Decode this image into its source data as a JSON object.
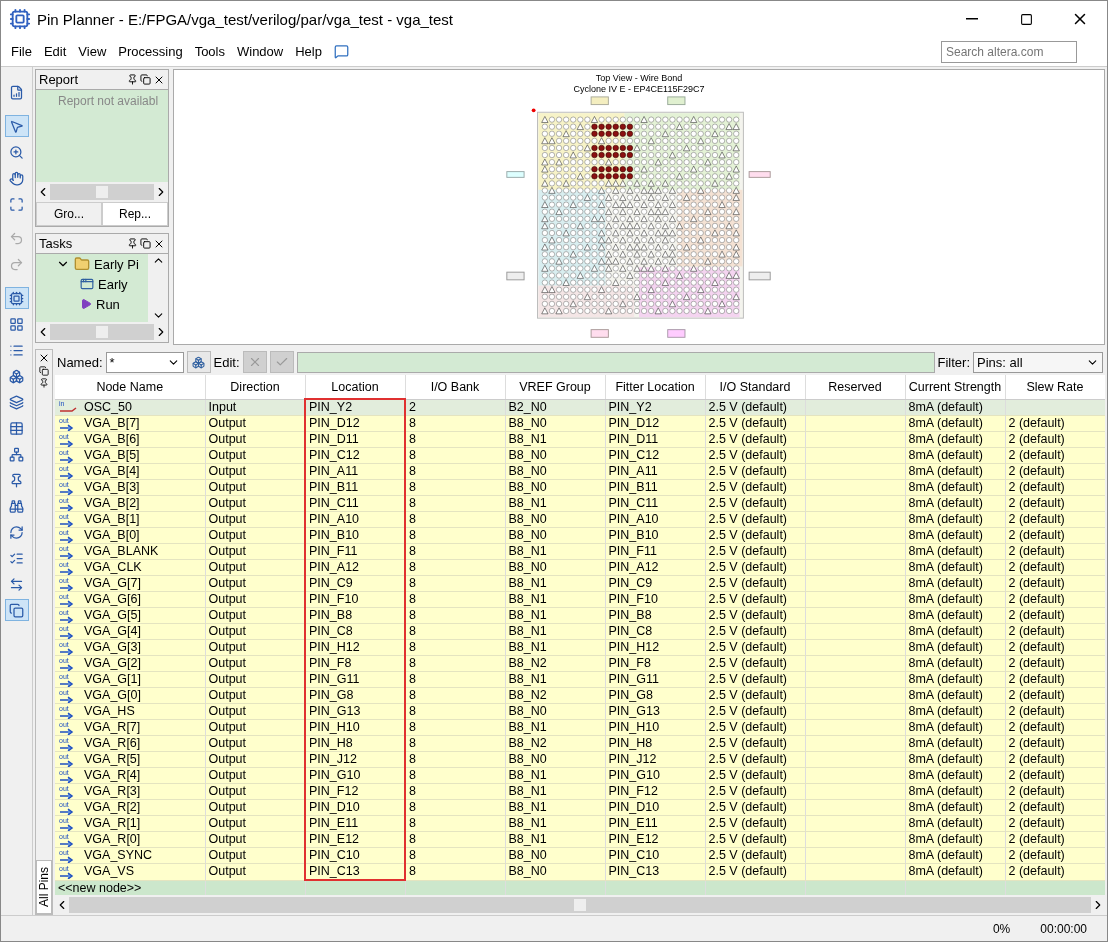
{
  "window": {
    "title": "Pin Planner - E:/FPGA/vga_test/verilog/par/vga_test - vga_test"
  },
  "menu": [
    "File",
    "Edit",
    "View",
    "Processing",
    "Tools",
    "Window",
    "Help"
  ],
  "search": {
    "placeholder": "Search altera.com"
  },
  "toolbar": [
    {
      "kind": "report",
      "selected": false,
      "disabled": false
    },
    {
      "kind": "pointer",
      "selected": true,
      "disabled": false
    },
    {
      "kind": "zoom",
      "selected": false,
      "disabled": false
    },
    {
      "kind": "hand",
      "selected": false,
      "disabled": false
    },
    {
      "kind": "fit",
      "selected": false,
      "disabled": false
    },
    {
      "kind": "undo",
      "selected": false,
      "disabled": true
    },
    {
      "kind": "redo",
      "selected": false,
      "disabled": true
    },
    {
      "kind": "chip",
      "selected": true,
      "disabled": false
    },
    {
      "kind": "grid",
      "selected": false,
      "disabled": false
    },
    {
      "kind": "list",
      "selected": false,
      "disabled": false
    },
    {
      "kind": "blocks",
      "selected": false,
      "disabled": false
    },
    {
      "kind": "layers",
      "selected": false,
      "disabled": false
    },
    {
      "kind": "table",
      "selected": false,
      "disabled": false
    },
    {
      "kind": "network",
      "selected": false,
      "disabled": false
    },
    {
      "kind": "pin",
      "selected": false,
      "disabled": false
    },
    {
      "kind": "binoculars",
      "selected": false,
      "disabled": false
    },
    {
      "kind": "cycle",
      "selected": false,
      "disabled": false
    },
    {
      "kind": "check",
      "selected": false,
      "disabled": false
    },
    {
      "kind": "io",
      "selected": false,
      "disabled": false
    },
    {
      "kind": "swap",
      "selected": true,
      "disabled": false
    }
  ],
  "report_panel": {
    "title": "Report",
    "message": "Report not availabl",
    "tabs": [
      {
        "label": "Gro...",
        "selected": false
      },
      {
        "label": "Rep...",
        "selected": true
      }
    ]
  },
  "tasks_panel": {
    "title": "Tasks",
    "tree": [
      {
        "label": "Early Pi",
        "expanded": true,
        "children": [
          {
            "label": "Early",
            "kind": "window"
          },
          {
            "label": "Run",
            "kind": "run"
          }
        ]
      }
    ]
  },
  "package_view": {
    "title": "Top View - Wire Bond",
    "subtitle": "Cyclone IV E - EP4CE115F29C7"
  },
  "filter_bar": {
    "named_label": "Named:",
    "named_value": "*",
    "edit_label": "Edit:",
    "filter_label": "Filter:",
    "filter_value": "Pins: all"
  },
  "side_tab": "All Pins",
  "table": {
    "columns": [
      {
        "label": "Node Name",
        "highlighted": false
      },
      {
        "label": "Direction",
        "highlighted": false
      },
      {
        "label": "Location",
        "highlighted": true
      },
      {
        "label": "I/O Bank",
        "highlighted": false
      },
      {
        "label": "VREF Group",
        "highlighted": false
      },
      {
        "label": "Fitter Location",
        "highlighted": false
      },
      {
        "label": "I/O Standard",
        "highlighted": false
      },
      {
        "label": "Reserved",
        "highlighted": false
      },
      {
        "label": "Current Strength",
        "highlighted": false
      },
      {
        "label": "Slew Rate",
        "highlighted": false
      }
    ],
    "rows": [
      {
        "kind": "input",
        "icon_label": "in",
        "cells": [
          "OSC_50",
          "Input",
          "PIN_Y2",
          "2",
          "B2_N0",
          "PIN_Y2",
          "2.5 V (default)",
          "",
          "8mA (default)",
          ""
        ]
      },
      {
        "kind": "output",
        "icon_label": "out",
        "cells": [
          "VGA_B[7]",
          "Output",
          "PIN_D12",
          "8",
          "B8_N0",
          "PIN_D12",
          "2.5 V (default)",
          "",
          "8mA (default)",
          "2 (default)"
        ]
      },
      {
        "kind": "output",
        "icon_label": "out",
        "cells": [
          "VGA_B[6]",
          "Output",
          "PIN_D11",
          "8",
          "B8_N1",
          "PIN_D11",
          "2.5 V (default)",
          "",
          "8mA (default)",
          "2 (default)"
        ]
      },
      {
        "kind": "output",
        "icon_label": "out",
        "cells": [
          "VGA_B[5]",
          "Output",
          "PIN_C12",
          "8",
          "B8_N0",
          "PIN_C12",
          "2.5 V (default)",
          "",
          "8mA (default)",
          "2 (default)"
        ]
      },
      {
        "kind": "output",
        "icon_label": "out",
        "cells": [
          "VGA_B[4]",
          "Output",
          "PIN_A11",
          "8",
          "B8_N0",
          "PIN_A11",
          "2.5 V (default)",
          "",
          "8mA (default)",
          "2 (default)"
        ]
      },
      {
        "kind": "output",
        "icon_label": "out",
        "cells": [
          "VGA_B[3]",
          "Output",
          "PIN_B11",
          "8",
          "B8_N0",
          "PIN_B11",
          "2.5 V (default)",
          "",
          "8mA (default)",
          "2 (default)"
        ]
      },
      {
        "kind": "output",
        "icon_label": "out",
        "cells": [
          "VGA_B[2]",
          "Output",
          "PIN_C11",
          "8",
          "B8_N1",
          "PIN_C11",
          "2.5 V (default)",
          "",
          "8mA (default)",
          "2 (default)"
        ]
      },
      {
        "kind": "output",
        "icon_label": "out",
        "cells": [
          "VGA_B[1]",
          "Output",
          "PIN_A10",
          "8",
          "B8_N0",
          "PIN_A10",
          "2.5 V (default)",
          "",
          "8mA (default)",
          "2 (default)"
        ]
      },
      {
        "kind": "output",
        "icon_label": "out",
        "cells": [
          "VGA_B[0]",
          "Output",
          "PIN_B10",
          "8",
          "B8_N0",
          "PIN_B10",
          "2.5 V (default)",
          "",
          "8mA (default)",
          "2 (default)"
        ]
      },
      {
        "kind": "output",
        "icon_label": "out",
        "cells": [
          "VGA_BLANK",
          "Output",
          "PIN_F11",
          "8",
          "B8_N1",
          "PIN_F11",
          "2.5 V (default)",
          "",
          "8mA (default)",
          "2 (default)"
        ]
      },
      {
        "kind": "output",
        "icon_label": "out",
        "cells": [
          "VGA_CLK",
          "Output",
          "PIN_A12",
          "8",
          "B8_N0",
          "PIN_A12",
          "2.5 V (default)",
          "",
          "8mA (default)",
          "2 (default)"
        ]
      },
      {
        "kind": "output",
        "icon_label": "out",
        "cells": [
          "VGA_G[7]",
          "Output",
          "PIN_C9",
          "8",
          "B8_N1",
          "PIN_C9",
          "2.5 V (default)",
          "",
          "8mA (default)",
          "2 (default)"
        ]
      },
      {
        "kind": "output",
        "icon_label": "out",
        "cells": [
          "VGA_G[6]",
          "Output",
          "PIN_F10",
          "8",
          "B8_N1",
          "PIN_F10",
          "2.5 V (default)",
          "",
          "8mA (default)",
          "2 (default)"
        ]
      },
      {
        "kind": "output",
        "icon_label": "out",
        "cells": [
          "VGA_G[5]",
          "Output",
          "PIN_B8",
          "8",
          "B8_N1",
          "PIN_B8",
          "2.5 V (default)",
          "",
          "8mA (default)",
          "2 (default)"
        ]
      },
      {
        "kind": "output",
        "icon_label": "out",
        "cells": [
          "VGA_G[4]",
          "Output",
          "PIN_C8",
          "8",
          "B8_N1",
          "PIN_C8",
          "2.5 V (default)",
          "",
          "8mA (default)",
          "2 (default)"
        ]
      },
      {
        "kind": "output",
        "icon_label": "out",
        "cells": [
          "VGA_G[3]",
          "Output",
          "PIN_H12",
          "8",
          "B8_N1",
          "PIN_H12",
          "2.5 V (default)",
          "",
          "8mA (default)",
          "2 (default)"
        ]
      },
      {
        "kind": "output",
        "icon_label": "out",
        "cells": [
          "VGA_G[2]",
          "Output",
          "PIN_F8",
          "8",
          "B8_N2",
          "PIN_F8",
          "2.5 V (default)",
          "",
          "8mA (default)",
          "2 (default)"
        ]
      },
      {
        "kind": "output",
        "icon_label": "out",
        "cells": [
          "VGA_G[1]",
          "Output",
          "PIN_G11",
          "8",
          "B8_N1",
          "PIN_G11",
          "2.5 V (default)",
          "",
          "8mA (default)",
          "2 (default)"
        ]
      },
      {
        "kind": "output",
        "icon_label": "out",
        "cells": [
          "VGA_G[0]",
          "Output",
          "PIN_G8",
          "8",
          "B8_N2",
          "PIN_G8",
          "2.5 V (default)",
          "",
          "8mA (default)",
          "2 (default)"
        ]
      },
      {
        "kind": "output",
        "icon_label": "out",
        "cells": [
          "VGA_HS",
          "Output",
          "PIN_G13",
          "8",
          "B8_N0",
          "PIN_G13",
          "2.5 V (default)",
          "",
          "8mA (default)",
          "2 (default)"
        ]
      },
      {
        "kind": "output",
        "icon_label": "out",
        "cells": [
          "VGA_R[7]",
          "Output",
          "PIN_H10",
          "8",
          "B8_N1",
          "PIN_H10",
          "2.5 V (default)",
          "",
          "8mA (default)",
          "2 (default)"
        ]
      },
      {
        "kind": "output",
        "icon_label": "out",
        "cells": [
          "VGA_R[6]",
          "Output",
          "PIN_H8",
          "8",
          "B8_N2",
          "PIN_H8",
          "2.5 V (default)",
          "",
          "8mA (default)",
          "2 (default)"
        ]
      },
      {
        "kind": "output",
        "icon_label": "out",
        "cells": [
          "VGA_R[5]",
          "Output",
          "PIN_J12",
          "8",
          "B8_N0",
          "PIN_J12",
          "2.5 V (default)",
          "",
          "8mA (default)",
          "2 (default)"
        ]
      },
      {
        "kind": "output",
        "icon_label": "out",
        "cells": [
          "VGA_R[4]",
          "Output",
          "PIN_G10",
          "8",
          "B8_N1",
          "PIN_G10",
          "2.5 V (default)",
          "",
          "8mA (default)",
          "2 (default)"
        ]
      },
      {
        "kind": "output",
        "icon_label": "out",
        "cells": [
          "VGA_R[3]",
          "Output",
          "PIN_F12",
          "8",
          "B8_N1",
          "PIN_F12",
          "2.5 V (default)",
          "",
          "8mA (default)",
          "2 (default)"
        ]
      },
      {
        "kind": "output",
        "icon_label": "out",
        "cells": [
          "VGA_R[2]",
          "Output",
          "PIN_D10",
          "8",
          "B8_N1",
          "PIN_D10",
          "2.5 V (default)",
          "",
          "8mA (default)",
          "2 (default)"
        ]
      },
      {
        "kind": "output",
        "icon_label": "out",
        "cells": [
          "VGA_R[1]",
          "Output",
          "PIN_E11",
          "8",
          "B8_N1",
          "PIN_E11",
          "2.5 V (default)",
          "",
          "8mA (default)",
          "2 (default)"
        ]
      },
      {
        "kind": "output",
        "icon_label": "out",
        "cells": [
          "VGA_R[0]",
          "Output",
          "PIN_E12",
          "8",
          "B8_N1",
          "PIN_E12",
          "2.5 V (default)",
          "",
          "8mA (default)",
          "2 (default)"
        ]
      },
      {
        "kind": "output",
        "icon_label": "out",
        "cells": [
          "VGA_SYNC",
          "Output",
          "PIN_C10",
          "8",
          "B8_N0",
          "PIN_C10",
          "2.5 V (default)",
          "",
          "8mA (default)",
          "2 (default)"
        ]
      },
      {
        "kind": "output",
        "icon_label": "out",
        "cells": [
          "VGA_VS",
          "Output",
          "PIN_C13",
          "8",
          "B8_N0",
          "PIN_C13",
          "2.5 V (default)",
          "",
          "8mA (default)",
          "2 (default)"
        ]
      }
    ],
    "new_node": "<<new node>>"
  },
  "status_bar": {
    "progress": "0%",
    "elapsed": "00:00:00"
  }
}
